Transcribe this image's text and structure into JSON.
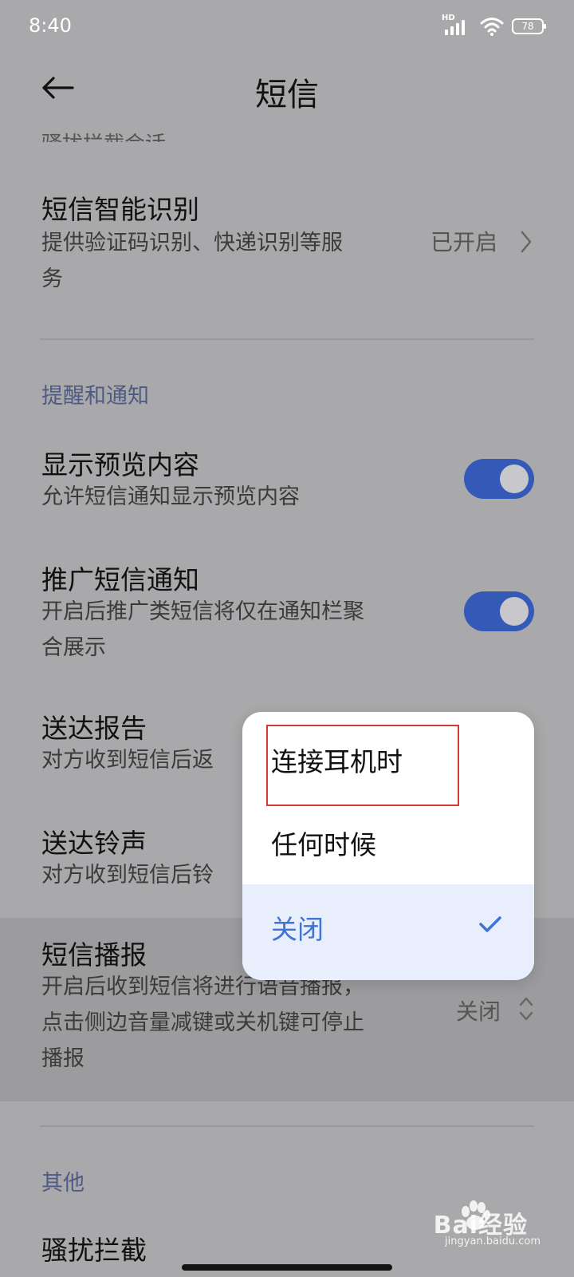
{
  "status_bar": {
    "time": "8:40",
    "network_label": "HD",
    "battery": "78"
  },
  "header": {
    "title": "短信"
  },
  "cut_off_item": "骚扰拦截会话",
  "smart_recognition": {
    "title": "短信智能识别",
    "desc_line1": "提供验证码识别、快递识别等服",
    "desc_line2": "务",
    "value": "已开启"
  },
  "section_notify": "提醒和通知",
  "preview": {
    "title": "显示预览内容",
    "desc": "允许短信通知显示预览内容",
    "enabled": true
  },
  "promo": {
    "title": "推广短信通知",
    "desc_line1": "开启后推广类短信将仅在通知栏聚",
    "desc_line2": "合展示",
    "enabled": true
  },
  "delivery_report": {
    "title": "送达报告",
    "desc": "对方收到短信后返"
  },
  "delivery_sound": {
    "title": "送达铃声",
    "desc": "对方收到短信后铃"
  },
  "sms_broadcast": {
    "title": "短信播报",
    "desc_line1": "开启后收到短信将进行语音播报，",
    "desc_line2": "点击侧边音量减键或关机键可停止",
    "desc_line3": "播报",
    "value": "关闭"
  },
  "section_other": "其他",
  "harass_block": {
    "title": "骚扰拦截"
  },
  "popup": {
    "options": [
      "连接耳机时",
      "任何时候",
      "关闭"
    ],
    "selected_index": 2
  },
  "watermark": {
    "brand": "Bai经验",
    "sub": "jingyan.baidu.com"
  },
  "colors": {
    "accent": "#3459b7",
    "selected_text": "#3f74d4",
    "annotation": "#d23a3a"
  }
}
